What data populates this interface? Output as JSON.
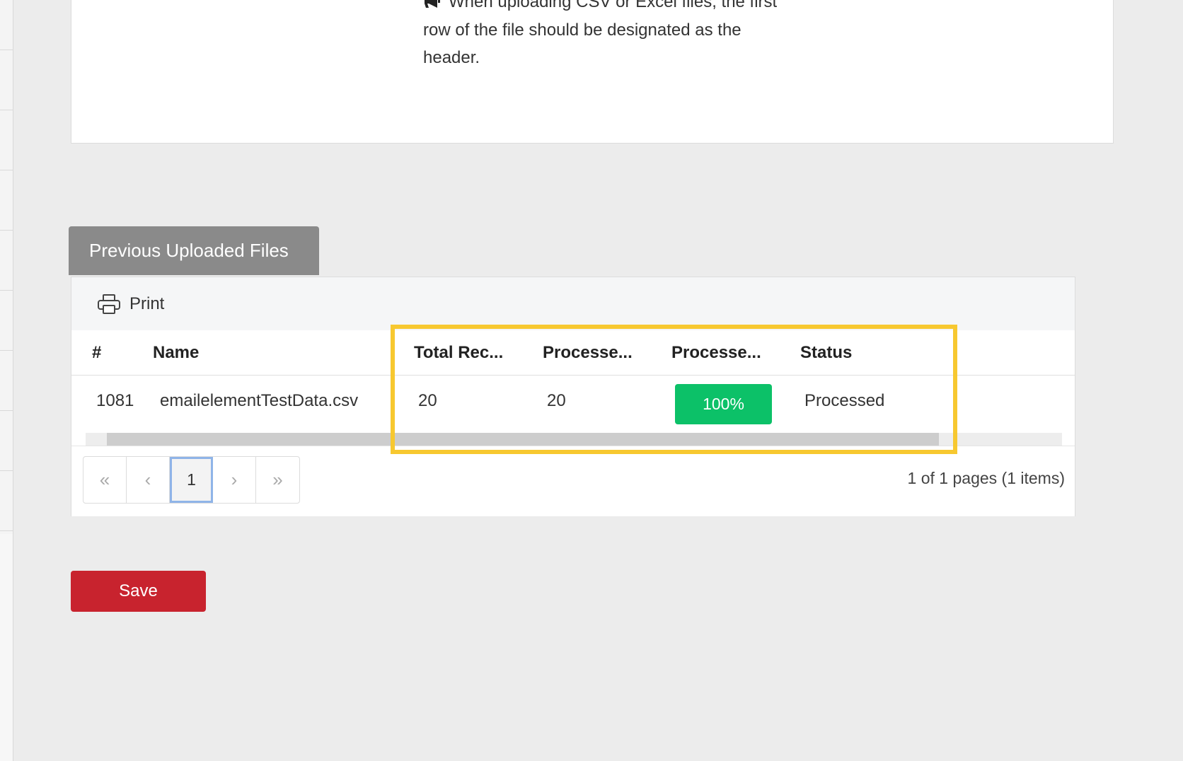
{
  "notice": {
    "icon": "megaphone-icon",
    "lines": [
      "When uploading CSV or Excel files, the first",
      "row of the file should be designated as the",
      "header."
    ]
  },
  "section": {
    "tab_title": "Previous Uploaded Files"
  },
  "toolbar": {
    "print_icon": "printer-icon",
    "print_label": "Print"
  },
  "table": {
    "columns": [
      "#",
      "Name",
      "Total Rec...",
      "Processe...",
      "Processe...",
      "Status"
    ],
    "rows": [
      {
        "id": "1081",
        "name": "emailelementTestData.csv",
        "total_records": "20",
        "processed": "20",
        "progress_label": "100%",
        "progress_value": 1.0,
        "status": "Processed"
      }
    ]
  },
  "pager": {
    "first": "«",
    "prev": "‹",
    "current": "1",
    "next": "›",
    "last": "»",
    "summary": "1 of 1 pages (1 items)"
  },
  "actions": {
    "save_label": "Save"
  },
  "colors": {
    "save": "#c8232e",
    "progress": "#0cc168",
    "highlight": "#f7c830",
    "tab": "#8a8a8a"
  }
}
